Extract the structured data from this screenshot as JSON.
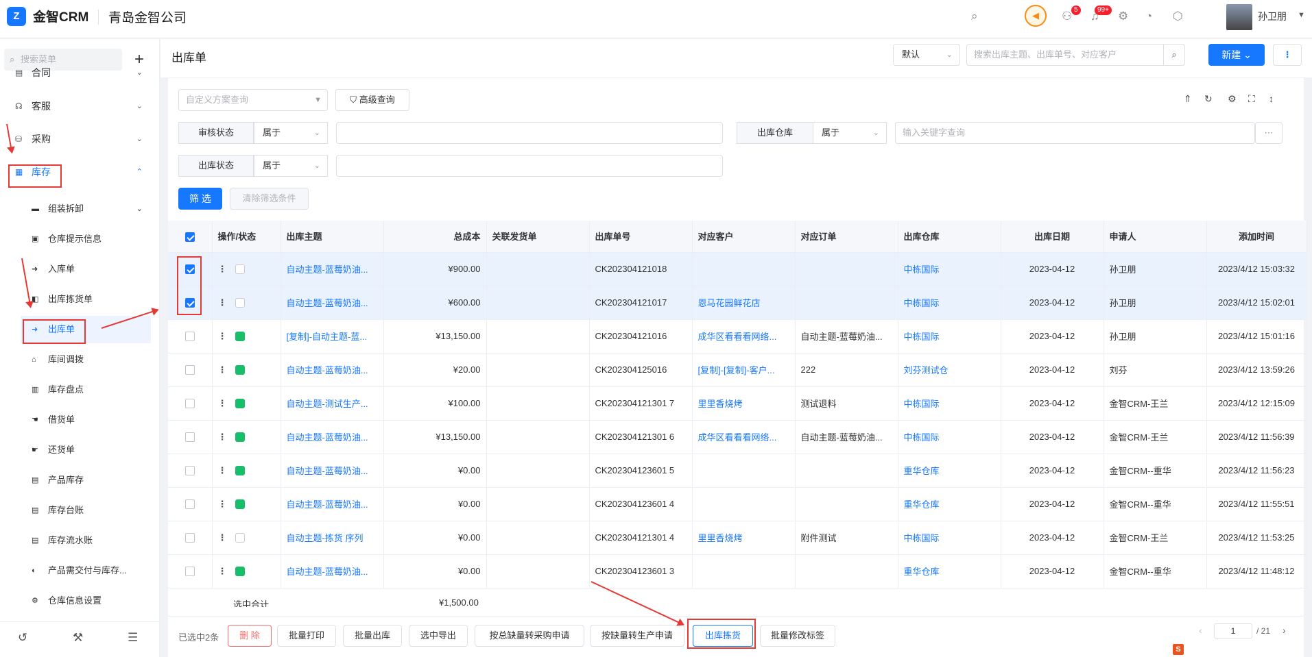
{
  "header": {
    "logo_text": "Z",
    "app_name": "金智CRM",
    "company": "青岛金智公司",
    "user": "孙卫朋",
    "badge_a": "5",
    "badge_b": "99+"
  },
  "sidebar": {
    "search_placeholder": "搜索菜单",
    "items": [
      {
        "label": "合同"
      },
      {
        "label": "客服"
      },
      {
        "label": "采购"
      },
      {
        "label": "库存"
      }
    ],
    "sub_items": [
      {
        "label": "组装拆卸"
      },
      {
        "label": "仓库提示信息"
      },
      {
        "label": "入库单"
      },
      {
        "label": "出库拣货单"
      },
      {
        "label": "出库单"
      },
      {
        "label": "库间调拨"
      },
      {
        "label": "库存盘点"
      },
      {
        "label": "借货单"
      },
      {
        "label": "还货单"
      },
      {
        "label": "产品库存"
      },
      {
        "label": "库存台账"
      },
      {
        "label": "库存流水账"
      },
      {
        "label": "产品需交付与库存..."
      },
      {
        "label": "仓库信息设置"
      }
    ]
  },
  "page": {
    "title": "出库单",
    "view_select": "默认",
    "search_placeholder": "搜索出库主题、出库单号、对应客户",
    "new_button": "新建"
  },
  "filters": {
    "scheme_placeholder": "自定义方案查询",
    "advanced": "高级查询",
    "audit_label": "审核状态",
    "audit_op": "属于",
    "warehouse_label": "出库仓库",
    "warehouse_op": "属于",
    "warehouse_placeholder": "输入关键字查询",
    "out_status_label": "出库状态",
    "out_status_op": "属于",
    "filter_btn": "筛 选",
    "clear_btn": "清除筛选条件"
  },
  "table": {
    "headers": [
      "操作/状态",
      "出库主题",
      "总成本",
      "关联发货单",
      "出库单号",
      "对应客户",
      "对应订单",
      "出库仓库",
      "出库日期",
      "申请人",
      "添加时间"
    ],
    "rows": [
      {
        "subject": "自动主题-蓝莓奶油...",
        "cost": "¥900.00",
        "ship": "",
        "no": "CK202304121018",
        "customer": "",
        "order": "",
        "warehouse": "中栋国际",
        "date": "2023-04-12",
        "applicant": "孙卫朋",
        "added": "2023/4/12 15:03:32"
      },
      {
        "subject": "自动主题-蓝莓奶油...",
        "cost": "¥600.00",
        "ship": "",
        "no": "CK202304121017",
        "customer": "恩马花园鲜花店",
        "order": "",
        "warehouse": "中栋国际",
        "date": "2023-04-12",
        "applicant": "孙卫朋",
        "added": "2023/4/12 15:02:01"
      },
      {
        "subject": "[复制]-自动主题-蓝...",
        "cost": "¥13,150.00",
        "ship": "",
        "no": "CK202304121016",
        "customer": "成华区看看看网络...",
        "order": "自动主题-蓝莓奶油...",
        "warehouse": "中栋国际",
        "date": "2023-04-12",
        "applicant": "孙卫朋",
        "added": "2023/4/12 15:01:16"
      },
      {
        "subject": "自动主题-蓝莓奶油...",
        "cost": "¥20.00",
        "ship": "",
        "no": "CK202304125016",
        "customer": "[复制]-[复制]-客户...",
        "order": "222",
        "warehouse": "刘芬测试仓",
        "date": "2023-04-12",
        "applicant": "刘芬",
        "added": "2023/4/12 13:59:26"
      },
      {
        "subject": "自动主题-测试生产...",
        "cost": "¥100.00",
        "ship": "",
        "no": "CK202304121301 7",
        "customer": "里里香烧烤",
        "order": "测试退料",
        "warehouse": "中栋国际",
        "date": "2023-04-12",
        "applicant": "金智CRM-王兰",
        "added": "2023/4/12 12:15:09"
      },
      {
        "subject": "自动主题-蓝莓奶油...",
        "cost": "¥13,150.00",
        "ship": "",
        "no": "CK202304121301 6",
        "customer": "成华区看看看网络...",
        "order": "自动主题-蓝莓奶油...",
        "warehouse": "中栋国际",
        "date": "2023-04-12",
        "applicant": "金智CRM-王兰",
        "added": "2023/4/12 11:56:39"
      },
      {
        "subject": "自动主题-蓝莓奶油...",
        "cost": "¥0.00",
        "ship": "",
        "no": "CK202304123601 5",
        "customer": "",
        "order": "",
        "warehouse": "重华仓库",
        "date": "2023-04-12",
        "applicant": "金智CRM--重华",
        "added": "2023/4/12 11:56:23"
      },
      {
        "subject": "自动主题-蓝莓奶油...",
        "cost": "¥0.00",
        "ship": "",
        "no": "CK202304123601 4",
        "customer": "",
        "order": "",
        "warehouse": "重华仓库",
        "date": "2023-04-12",
        "applicant": "金智CRM--重华",
        "added": "2023/4/12 11:55:51"
      },
      {
        "subject": "自动主题-拣货 序列",
        "cost": "¥0.00",
        "ship": "",
        "no": "CK202304121301 4",
        "customer": "里里香烧烤",
        "order": "附件测试",
        "warehouse": "中栋国际",
        "date": "2023-04-12",
        "applicant": "金智CRM-王兰",
        "added": "2023/4/12 11:53:25"
      },
      {
        "subject": "自动主题-蓝莓奶油...",
        "cost": "¥0.00",
        "ship": "",
        "no": "CK202304123601 3",
        "customer": "",
        "order": "",
        "warehouse": "重华仓库",
        "date": "2023-04-12",
        "applicant": "金智CRM--重华",
        "added": "2023/4/12 11:48:12"
      }
    ],
    "summary_label": "选中合计",
    "summary_cost": "¥1,500.00"
  },
  "footer": {
    "selected": "已选中2条",
    "delete": "删 除",
    "batch_print": "批量打印",
    "batch_out": "批量出库",
    "export": "选中导出",
    "to_purchase": "按总缺量转采购申请",
    "to_production": "按缺量转生产申请",
    "pick": "出库拣货",
    "batch_tag": "批量修改标签",
    "page": "1",
    "total_pages": "/ 21"
  }
}
